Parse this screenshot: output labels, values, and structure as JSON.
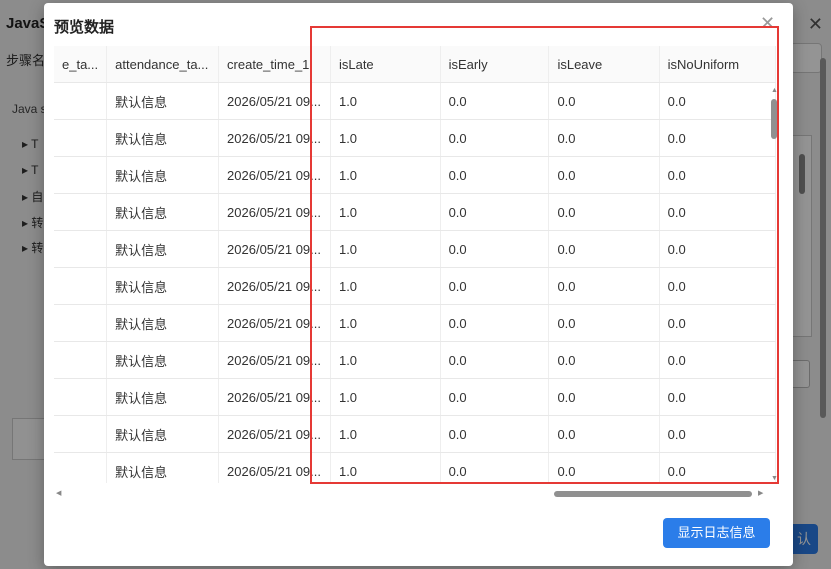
{
  "background": {
    "title": "JavaS",
    "step_label": "步骤名",
    "js_label": "Java s",
    "tree_items": [
      "▸ T",
      "▸ T",
      "▸ 自",
      "▸ 转",
      "▸ 转"
    ],
    "close": "✕",
    "right_button": "认"
  },
  "modal": {
    "title": "预览数据",
    "close": "✕",
    "log_button": "显示日志信息"
  },
  "table": {
    "columns": [
      "e_ta...",
      "attendance_ta...",
      "create_time_1",
      "isLate",
      "isEarly",
      "isLeave",
      "isNoUniform"
    ],
    "rows": [
      [
        "",
        "默认信息",
        "2026/05/21 09...",
        "1.0",
        "0.0",
        "0.0",
        "0.0"
      ],
      [
        "",
        "默认信息",
        "2026/05/21 09...",
        "1.0",
        "0.0",
        "0.0",
        "0.0"
      ],
      [
        "",
        "默认信息",
        "2026/05/21 09...",
        "1.0",
        "0.0",
        "0.0",
        "0.0"
      ],
      [
        "",
        "默认信息",
        "2026/05/21 09...",
        "1.0",
        "0.0",
        "0.0",
        "0.0"
      ],
      [
        "",
        "默认信息",
        "2026/05/21 09...",
        "1.0",
        "0.0",
        "0.0",
        "0.0"
      ],
      [
        "",
        "默认信息",
        "2026/05/21 09...",
        "1.0",
        "0.0",
        "0.0",
        "0.0"
      ],
      [
        "",
        "默认信息",
        "2026/05/21 09...",
        "1.0",
        "0.0",
        "0.0",
        "0.0"
      ],
      [
        "",
        "默认信息",
        "2026/05/21 09...",
        "1.0",
        "0.0",
        "0.0",
        "0.0"
      ],
      [
        "",
        "默认信息",
        "2026/05/21 09...",
        "1.0",
        "0.0",
        "0.0",
        "0.0"
      ],
      [
        "",
        "默认信息",
        "2026/05/21 09...",
        "1.0",
        "0.0",
        "0.0",
        "0.0"
      ],
      [
        "",
        "默认信息",
        "2026/05/21 09...",
        "1.0",
        "0.0",
        "0.0",
        "0.0"
      ],
      [
        "",
        "",
        "",
        "",
        "",
        "",
        ""
      ]
    ]
  },
  "colors": {
    "highlight": "#e53935",
    "primary": "#2b7de9"
  }
}
